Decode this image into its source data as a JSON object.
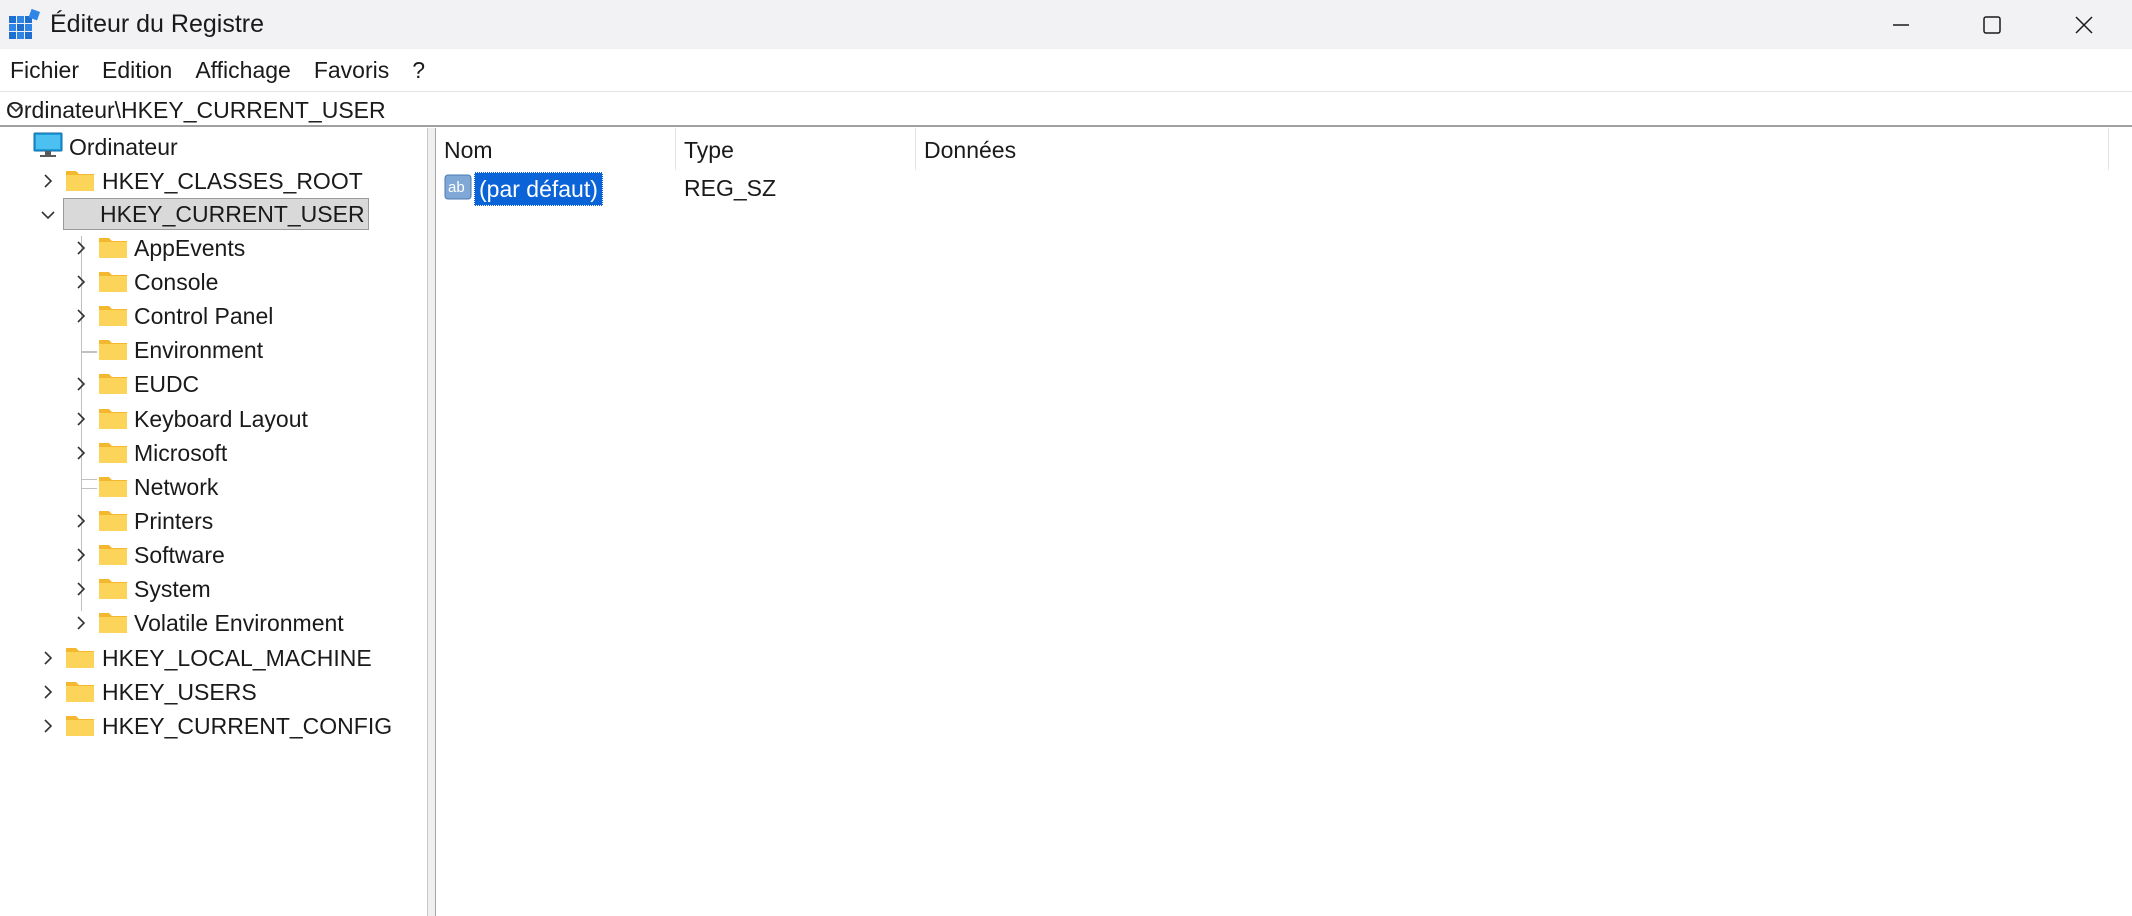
{
  "window": {
    "title": "Éditeur du Registre",
    "controls": {
      "minimize": "minimize-icon",
      "maximize": "maximize-icon",
      "close": "close-icon"
    }
  },
  "menu": {
    "items": [
      "Fichier",
      "Edition",
      "Affichage",
      "Favoris",
      "?"
    ]
  },
  "address": {
    "path": "Ordinateur\\HKEY_CURRENT_USER"
  },
  "tree": {
    "root": "Ordinateur",
    "hives": [
      "HKEY_CLASSES_ROOT",
      "HKEY_CURRENT_USER",
      "HKEY_LOCAL_MACHINE",
      "HKEY_USERS",
      "HKEY_CURRENT_CONFIG"
    ],
    "selected": "HKEY_CURRENT_USER",
    "children": [
      "AppEvents",
      "Console",
      "Control Panel",
      "Environment",
      "EUDC",
      "Keyboard Layout",
      "Microsoft",
      "Network",
      "Printers",
      "Software",
      "System",
      "Volatile Environment"
    ]
  },
  "list": {
    "columns": [
      "Nom",
      "Type",
      "Données"
    ],
    "rows": [
      {
        "name": "(par défaut)",
        "type": "REG_SZ",
        "data": ""
      }
    ]
  },
  "colors": {
    "titlebar_bg": "#f2f2f4",
    "selection_blue": "#0a64d8",
    "folder_yellow": "#f9c83c",
    "tree_selected_bg": "#d9d9d9"
  }
}
